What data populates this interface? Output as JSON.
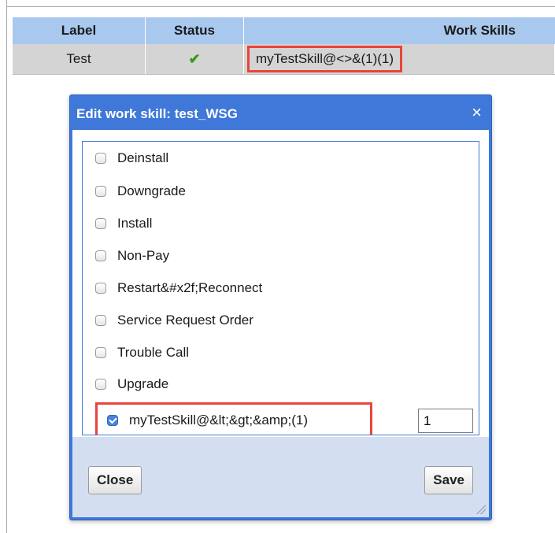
{
  "table": {
    "headers": {
      "label": "Label",
      "status": "Status",
      "work_skills": "Work Skills"
    },
    "row": {
      "label": "Test",
      "status_icon": "check-icon",
      "status_glyph": "✔",
      "work_skill": "myTestSkill@<>&(1)(1)"
    }
  },
  "dialog": {
    "title": "Edit work skill: test_WSG",
    "close_glyph": "×",
    "items": [
      {
        "label": "Deinstall",
        "checked": false
      },
      {
        "label": "Downgrade",
        "checked": false
      },
      {
        "label": "Install",
        "checked": false
      },
      {
        "label": "Non-Pay",
        "checked": false
      },
      {
        "label": "Restart&#x2f;Reconnect",
        "checked": false
      },
      {
        "label": "Service Request Order",
        "checked": false
      },
      {
        "label": "Trouble Call",
        "checked": false
      },
      {
        "label": "Upgrade",
        "checked": false
      }
    ],
    "selected": {
      "label": "myTestSkill@&lt;&gt;&amp;(1)",
      "checked": true,
      "quantity": "1"
    },
    "close_button": "Close",
    "save_button": "Save"
  },
  "colors": {
    "accent": "#3f78d8",
    "header_bg": "#a8c8ee",
    "highlight": "#e8453c",
    "check": "#3a9a1a"
  }
}
